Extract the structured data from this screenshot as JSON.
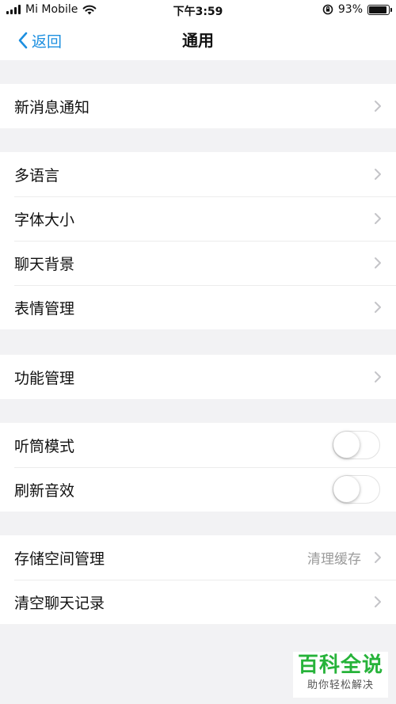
{
  "status_bar": {
    "carrier": "Mi Mobile",
    "time": "下午3:59",
    "battery_percent": "93%",
    "battery_level": 0.93
  },
  "nav": {
    "back_label": "返回",
    "title": "通用"
  },
  "sections": [
    {
      "rows": [
        {
          "label": "新消息通知"
        }
      ]
    },
    {
      "rows": [
        {
          "label": "多语言"
        },
        {
          "label": "字体大小"
        },
        {
          "label": "聊天背景"
        },
        {
          "label": "表情管理"
        }
      ]
    },
    {
      "rows": [
        {
          "label": "功能管理"
        }
      ]
    },
    {
      "rows": [
        {
          "label": "听筒模式",
          "toggle": false
        },
        {
          "label": "刷新音效",
          "toggle": false
        }
      ]
    },
    {
      "rows": [
        {
          "label": "存储空间管理",
          "value": "清理缓存"
        },
        {
          "label": "清空聊天记录"
        }
      ]
    }
  ],
  "watermark": {
    "main": "百科全说",
    "sub": "助你轻松解决"
  },
  "colors": {
    "accent": "#1c8fe0",
    "background": "#f2f2f4",
    "watermark_green": "#27b33a"
  }
}
